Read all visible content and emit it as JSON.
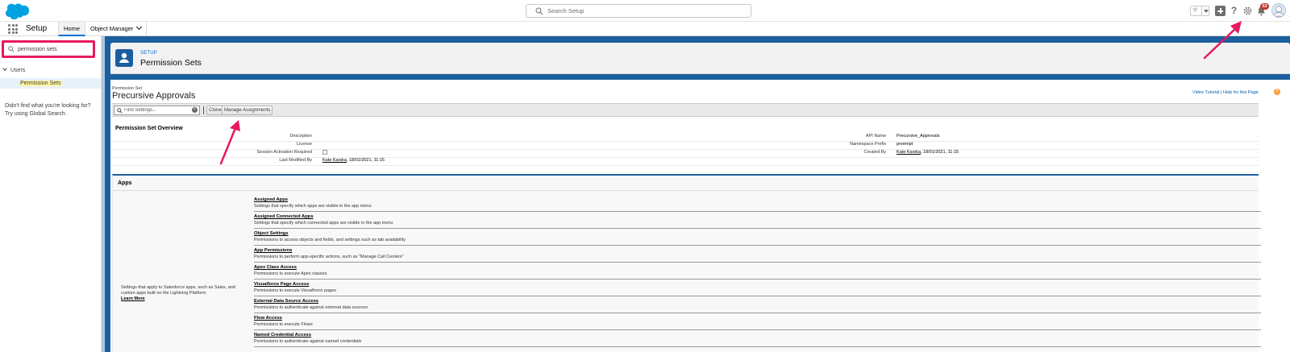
{
  "header": {
    "search_placeholder": "Search Setup",
    "notification_count": "53",
    "icons": [
      "favorites-star-icon",
      "add-icon",
      "help-icon",
      "gear-icon",
      "bell-icon"
    ]
  },
  "nav": {
    "app_name": "Setup",
    "tabs": [
      {
        "label": "Home"
      },
      {
        "label": "Object Manager"
      }
    ]
  },
  "sidebar": {
    "quickfind_value": "permission sets",
    "tree": {
      "group": "Users",
      "item": "Permission Sets"
    },
    "not_found_text": "Didn't find what you're looking for? Try using Global Search."
  },
  "page": {
    "breadcrumb": "SETUP",
    "title": "Permission Sets",
    "record_label": "Permission Set",
    "record_name": "Precursive Approvals",
    "help_links": "Video Tutorial | Help for this Page",
    "help_badge": "?"
  },
  "toolbar": {
    "find_placeholder": "Find Settings...",
    "clone_label": "Clone",
    "manage_label": "Manage Assignments"
  },
  "overview": {
    "title": "Permission Set Overview",
    "rows": [
      {
        "label_left": "Description",
        "value_left": "",
        "label_right": "API Name",
        "value_right": "Precursive_Approvals"
      },
      {
        "label_left": "License",
        "value_left": "",
        "label_right": "Namespace Prefix",
        "value_right": "preempt"
      },
      {
        "label_left": "Session Activation Required",
        "value_left": "",
        "label_right": "Created By",
        "value_right_link": "Kate Karska",
        "value_right": ", 18/01/2021, 11:15"
      },
      {
        "label_left": "Last Modified By",
        "value_left_link": "Kate Karska",
        "value_left": ", 18/01/2021, 11:15"
      }
    ]
  },
  "apps": {
    "title": "Apps",
    "description": "Settings that apply to Salesforce apps, such as Sales, and custom apps built on the Lightning Platform",
    "learn_more": "Learn More",
    "items": [
      {
        "title": "Assigned Apps",
        "desc": "Settings that specify which apps are visible in the app menu"
      },
      {
        "title": "Assigned Connected Apps",
        "desc": "Settings that specify which connected apps are visible in the app menu"
      },
      {
        "title": "Object Settings",
        "desc": "Permissions to access objects and fields, and settings such as tab availability"
      },
      {
        "title": "App Permissions",
        "desc": "Permissions to perform app-specific actions, such as \"Manage Call Centers\""
      },
      {
        "title": "Apex Class Access",
        "desc": "Permissions to execute Apex classes"
      },
      {
        "title": "Visualforce Page Access",
        "desc": "Permissions to execute Visualforce pages"
      },
      {
        "title": "External Data Source Access",
        "desc": "Permissions to authenticate against external data sources"
      },
      {
        "title": "Flow Access",
        "desc": "Permissions to execute Flows"
      },
      {
        "title": "Named Credential Access",
        "desc": "Permissions to authenticate against named credentials"
      }
    ]
  },
  "colors": {
    "brand_blue": "#1b5f9e",
    "highlight_pink": "#e8195d",
    "link_blue": "#0070d2"
  }
}
